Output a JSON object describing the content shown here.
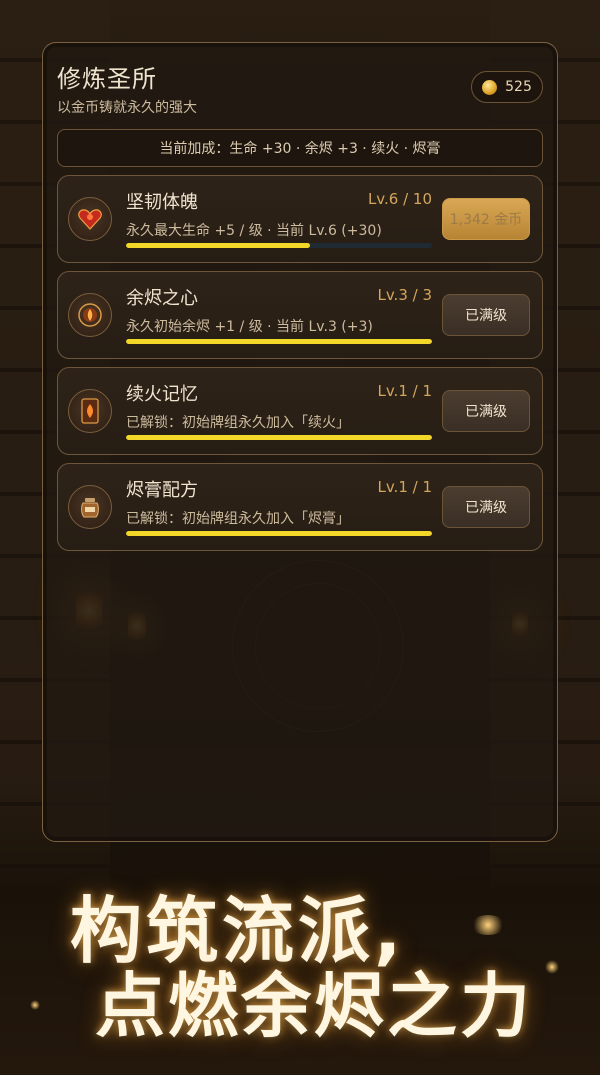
{
  "header": {
    "title": "修炼圣所",
    "subtitle": "以金币铸就永久的强大",
    "gold": "525"
  },
  "bonus_bar": {
    "text": "当前加成：生命 +30 · 余烬 +3 · 续火 · 烬膏"
  },
  "cards": [
    {
      "name": "坚韧体魄",
      "level": "Lv.6 / 10",
      "desc": "永久最大生命 +5 / 级 · 当前 Lv.6 (+30)",
      "progress": 0.6,
      "button": "1,342 金币",
      "icon": "heart-gem-icon"
    },
    {
      "name": "余烬之心",
      "level": "Lv.3 / 3",
      "desc": "永久初始余烬 +1 / 级 · 当前 Lv.3 (+3)",
      "progress": 1.0,
      "button": "已满级",
      "icon": "ember-core-icon"
    },
    {
      "name": "续火记忆",
      "level": "Lv.1 / 1",
      "desc": "已解锁：初始牌组永久加入「续火」",
      "progress": 1.0,
      "button": "已满级",
      "icon": "flame-card-icon"
    },
    {
      "name": "烬膏配方",
      "level": "Lv.1 / 1",
      "desc": "已解锁：初始牌组永久加入「烬膏」",
      "progress": 1.0,
      "button": "已满级",
      "icon": "salve-jar-icon"
    }
  ],
  "slogan": {
    "line1": "构筑流派,",
    "line2": "点燃余烬之力"
  },
  "colors": {
    "accent_gold": "#d3a65e",
    "progress_yellow": "#f2d628",
    "panel_border": "#7b6142"
  }
}
